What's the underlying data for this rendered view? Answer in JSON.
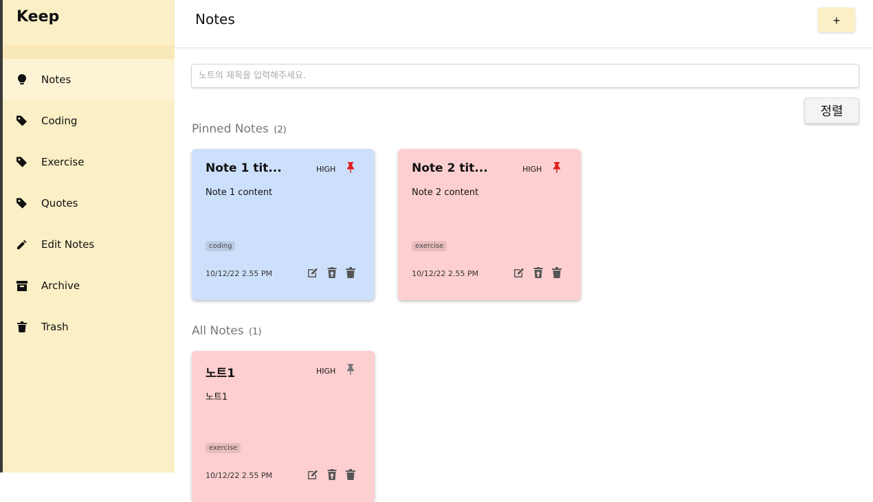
{
  "app": {
    "brand": "Keep"
  },
  "sidebar": {
    "items": [
      {
        "label": "Notes",
        "icon": "lightbulb-icon",
        "active": true
      },
      {
        "label": "Coding",
        "icon": "tag-icon"
      },
      {
        "label": "Exercise",
        "icon": "tag-icon"
      },
      {
        "label": "Quotes",
        "icon": "tag-icon"
      },
      {
        "label": "Edit Notes",
        "icon": "pencil-icon"
      },
      {
        "label": "Archive",
        "icon": "archive-icon"
      },
      {
        "label": "Trash",
        "icon": "trash-icon"
      }
    ]
  },
  "header": {
    "title": "Notes",
    "add_label": "+"
  },
  "search": {
    "placeholder": "노트의 제목을 입력해주세요.",
    "value": ""
  },
  "sort": {
    "label": "정렬"
  },
  "pinned": {
    "title": "Pinned Notes",
    "count": "(2)",
    "notes": [
      {
        "title": "Note 1 tit...",
        "priority": "HIGH",
        "content": "Note 1 content",
        "tag": "coding",
        "date": "10/12/22 2.55 PM",
        "color": "#cde0fb",
        "pinned": true
      },
      {
        "title": "Note 2 tit...",
        "priority": "HIGH",
        "content": "Note 2 content",
        "tag": "exercise",
        "date": "10/12/22 2.55 PM",
        "color": "#fdcfd0",
        "pinned": true
      }
    ]
  },
  "all": {
    "title": "All Notes",
    "count": "(1)",
    "notes": [
      {
        "title": "노트1",
        "priority": "HIGH",
        "content": "노트1",
        "tag": "exercise",
        "date": "10/12/22 2.55 PM",
        "color": "#fdcfd0",
        "pinned": false
      }
    ]
  },
  "colors": {
    "sidebar_bg": "#fbefc6",
    "pin_active": "#e02020",
    "pin_inactive": "#777777"
  }
}
